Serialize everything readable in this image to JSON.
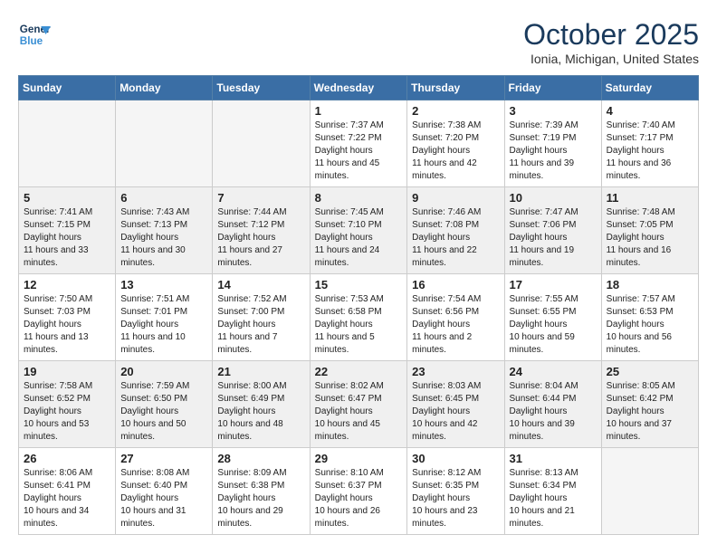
{
  "logo": {
    "line1": "General",
    "line2": "Blue"
  },
  "header": {
    "month": "October 2025",
    "location": "Ionia, Michigan, United States"
  },
  "weekdays": [
    "Sunday",
    "Monday",
    "Tuesday",
    "Wednesday",
    "Thursday",
    "Friday",
    "Saturday"
  ],
  "weeks": [
    [
      {
        "day": "",
        "empty": true
      },
      {
        "day": "",
        "empty": true
      },
      {
        "day": "",
        "empty": true
      },
      {
        "day": "1",
        "sunrise": "7:37 AM",
        "sunset": "7:22 PM",
        "daylight": "11 hours and 45 minutes."
      },
      {
        "day": "2",
        "sunrise": "7:38 AM",
        "sunset": "7:20 PM",
        "daylight": "11 hours and 42 minutes."
      },
      {
        "day": "3",
        "sunrise": "7:39 AM",
        "sunset": "7:19 PM",
        "daylight": "11 hours and 39 minutes."
      },
      {
        "day": "4",
        "sunrise": "7:40 AM",
        "sunset": "7:17 PM",
        "daylight": "11 hours and 36 minutes."
      }
    ],
    [
      {
        "day": "5",
        "sunrise": "7:41 AM",
        "sunset": "7:15 PM",
        "daylight": "11 hours and 33 minutes."
      },
      {
        "day": "6",
        "sunrise": "7:43 AM",
        "sunset": "7:13 PM",
        "daylight": "11 hours and 30 minutes."
      },
      {
        "day": "7",
        "sunrise": "7:44 AM",
        "sunset": "7:12 PM",
        "daylight": "11 hours and 27 minutes."
      },
      {
        "day": "8",
        "sunrise": "7:45 AM",
        "sunset": "7:10 PM",
        "daylight": "11 hours and 24 minutes."
      },
      {
        "day": "9",
        "sunrise": "7:46 AM",
        "sunset": "7:08 PM",
        "daylight": "11 hours and 22 minutes."
      },
      {
        "day": "10",
        "sunrise": "7:47 AM",
        "sunset": "7:06 PM",
        "daylight": "11 hours and 19 minutes."
      },
      {
        "day": "11",
        "sunrise": "7:48 AM",
        "sunset": "7:05 PM",
        "daylight": "11 hours and 16 minutes."
      }
    ],
    [
      {
        "day": "12",
        "sunrise": "7:50 AM",
        "sunset": "7:03 PM",
        "daylight": "11 hours and 13 minutes."
      },
      {
        "day": "13",
        "sunrise": "7:51 AM",
        "sunset": "7:01 PM",
        "daylight": "11 hours and 10 minutes."
      },
      {
        "day": "14",
        "sunrise": "7:52 AM",
        "sunset": "7:00 PM",
        "daylight": "11 hours and 7 minutes."
      },
      {
        "day": "15",
        "sunrise": "7:53 AM",
        "sunset": "6:58 PM",
        "daylight": "11 hours and 5 minutes."
      },
      {
        "day": "16",
        "sunrise": "7:54 AM",
        "sunset": "6:56 PM",
        "daylight": "11 hours and 2 minutes."
      },
      {
        "day": "17",
        "sunrise": "7:55 AM",
        "sunset": "6:55 PM",
        "daylight": "10 hours and 59 minutes."
      },
      {
        "day": "18",
        "sunrise": "7:57 AM",
        "sunset": "6:53 PM",
        "daylight": "10 hours and 56 minutes."
      }
    ],
    [
      {
        "day": "19",
        "sunrise": "7:58 AM",
        "sunset": "6:52 PM",
        "daylight": "10 hours and 53 minutes."
      },
      {
        "day": "20",
        "sunrise": "7:59 AM",
        "sunset": "6:50 PM",
        "daylight": "10 hours and 50 minutes."
      },
      {
        "day": "21",
        "sunrise": "8:00 AM",
        "sunset": "6:49 PM",
        "daylight": "10 hours and 48 minutes."
      },
      {
        "day": "22",
        "sunrise": "8:02 AM",
        "sunset": "6:47 PM",
        "daylight": "10 hours and 45 minutes."
      },
      {
        "day": "23",
        "sunrise": "8:03 AM",
        "sunset": "6:45 PM",
        "daylight": "10 hours and 42 minutes."
      },
      {
        "day": "24",
        "sunrise": "8:04 AM",
        "sunset": "6:44 PM",
        "daylight": "10 hours and 39 minutes."
      },
      {
        "day": "25",
        "sunrise": "8:05 AM",
        "sunset": "6:42 PM",
        "daylight": "10 hours and 37 minutes."
      }
    ],
    [
      {
        "day": "26",
        "sunrise": "8:06 AM",
        "sunset": "6:41 PM",
        "daylight": "10 hours and 34 minutes."
      },
      {
        "day": "27",
        "sunrise": "8:08 AM",
        "sunset": "6:40 PM",
        "daylight": "10 hours and 31 minutes."
      },
      {
        "day": "28",
        "sunrise": "8:09 AM",
        "sunset": "6:38 PM",
        "daylight": "10 hours and 29 minutes."
      },
      {
        "day": "29",
        "sunrise": "8:10 AM",
        "sunset": "6:37 PM",
        "daylight": "10 hours and 26 minutes."
      },
      {
        "day": "30",
        "sunrise": "8:12 AM",
        "sunset": "6:35 PM",
        "daylight": "10 hours and 23 minutes."
      },
      {
        "day": "31",
        "sunrise": "8:13 AM",
        "sunset": "6:34 PM",
        "daylight": "10 hours and 21 minutes."
      },
      {
        "day": "",
        "empty": true
      }
    ]
  ]
}
